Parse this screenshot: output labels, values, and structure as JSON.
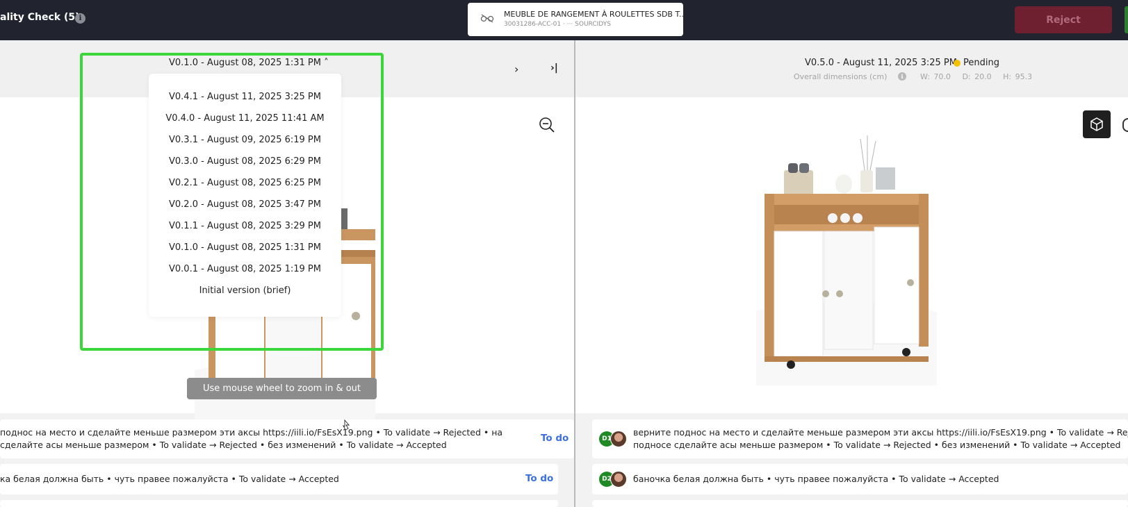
{
  "header": {
    "title": "ality Check (5)",
    "product_name": "MEUBLE DE RANGEMENT À ROULETTES SDB T...",
    "product_ref": "30031286-ACC-01 ·",
    "product_brand": "··· SOURCIDYS",
    "reject_label": "Reject"
  },
  "left_panel": {
    "version_label": "V0.1.0 - August 08, 2025 1:31 PM ˄",
    "next_icon": "chevron-right-icon",
    "last_icon": "skip-last-icon",
    "zoom_hint": "Use mouse wheel to zoom in & out",
    "dropdown": [
      "V0.4.1 - August 11, 2025 3:25 PM",
      "V0.4.0 - August 11, 2025 11:41 AM",
      "V0.3.1 - August 09, 2025 6:19 PM",
      "V0.3.0 - August 08, 2025 6:29 PM",
      "V0.2.1 - August 08, 2025 6:25 PM",
      "V0.2.0 - August 08, 2025 3:47 PM",
      "V0.1.1 - August 08, 2025 3:29 PM",
      "V0.1.0 - August 08, 2025 1:31 PM",
      "V0.0.1 - August 08, 2025 1:19 PM",
      "Initial version (brief)"
    ],
    "comments": [
      {
        "line1": "поднос на место и сделайте меньше размером эти аксы https://iili.io/FsEsX19.png • To validate → Rejected • на",
        "line2": "сделайте асы меньше размером • To validate → Rejected • без изменений • To validate → Accepted",
        "status": "To do"
      },
      {
        "line1": "ка белая должна быть • чуть правее пожалуйста • To validate → Accepted",
        "status": "To do"
      }
    ]
  },
  "right_panel": {
    "version_label": "V0.5.0 - August 11, 2025 3:25 PM",
    "status": "Pending",
    "status_color": "#f2c200",
    "dims_label": "Overall dimensions (cm)",
    "dims_w": "W: 70.0",
    "dims_d": "D: 20.0",
    "dims_h": "H: 95.3",
    "comments": [
      {
        "avatar": "D1",
        "line1": "верните поднос на место и сделайте меньше размером эти аксы https://iili.io/FsEsX19.png • To validate → Rejected •",
        "line2": "подносе сделайте асы меньше размером • To validate → Rejected • без изменений • To validate → Accepted"
      },
      {
        "avatar": "D2",
        "line1": "баночка белая должна быть • чуть правее пожалуйста • To validate → Accepted"
      }
    ]
  },
  "colors": {
    "header_bg": "#21242e",
    "reject_bg": "#6e1f30",
    "highlight": "#3ad63a",
    "todo": "#3b6fe0",
    "avatar": "#1f8a25"
  }
}
